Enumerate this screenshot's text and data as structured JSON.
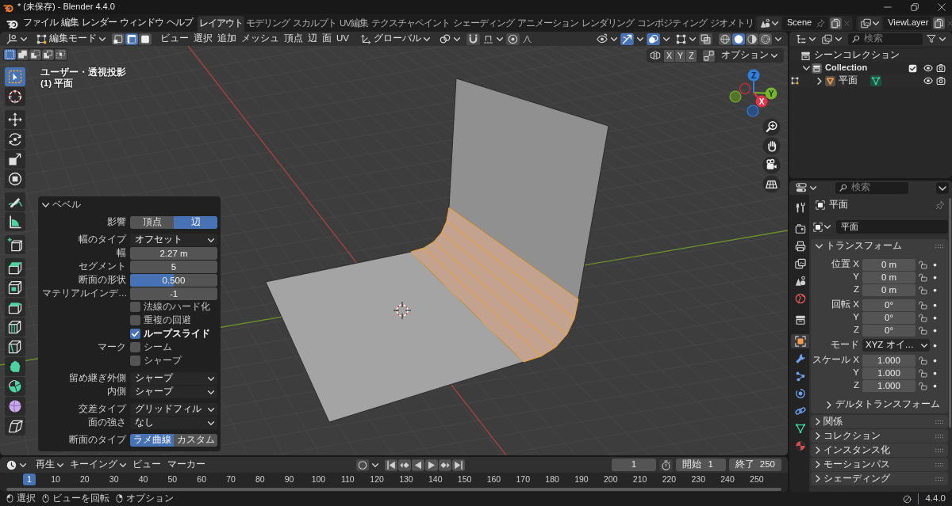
{
  "title_bar": {
    "title": "* (未保存) - Blender 4.4.0"
  },
  "top_bar": {
    "menus": [
      "ファイル",
      "編集",
      "レンダー",
      "ウィンドウ",
      "ヘルプ"
    ],
    "workspaces": [
      {
        "label": "レイアウト",
        "selected": true
      },
      {
        "label": "モデリング",
        "selected": false
      },
      {
        "label": "スカルプト",
        "selected": false
      },
      {
        "label": "UV編集",
        "selected": false
      },
      {
        "label": "テクスチャペイント",
        "selected": false
      },
      {
        "label": "シェーディング",
        "selected": false
      },
      {
        "label": "アニメーション",
        "selected": false
      },
      {
        "label": "レンダリング",
        "selected": false
      },
      {
        "label": "コンポジティング",
        "selected": false
      },
      {
        "label": "ジオメトリ",
        "selected": false
      }
    ],
    "scene": "Scene",
    "view_layer": "ViewLayer"
  },
  "viewport_header": {
    "mode": "編集モード",
    "select_modes": [
      {
        "kind": "vertex",
        "selected": false
      },
      {
        "kind": "edge",
        "selected": true
      },
      {
        "kind": "face",
        "selected": false
      }
    ],
    "menus": [
      "ビュー",
      "選択",
      "追加",
      "メッシュ",
      "頂点",
      "辺",
      "面",
      "UV"
    ],
    "orientation": "グローバル",
    "toggles": [
      {
        "kind": "snap",
        "on": false
      },
      {
        "kind": "proportional",
        "on": false
      },
      {
        "kind": "gizmos",
        "on": true
      },
      {
        "kind": "overlays",
        "on": true
      },
      {
        "kind": "xray",
        "on": false
      }
    ],
    "shading_modes": [
      {
        "kind": "wireframe",
        "selected": false
      },
      {
        "kind": "solid",
        "selected": true
      },
      {
        "kind": "material",
        "selected": false
      },
      {
        "kind": "rendered",
        "selected": false
      }
    ]
  },
  "viewport": {
    "selection_ops": [
      {
        "kind": "set",
        "selected": true
      },
      {
        "kind": "extend",
        "selected": false
      },
      {
        "kind": "subtract",
        "selected": false
      },
      {
        "kind": "invert",
        "selected": false
      },
      {
        "kind": "intersect",
        "selected": false
      }
    ],
    "view_name": "ユーザー・透視投影",
    "object_label": "(1) 平面",
    "mirror_axes": [
      {
        "label": "X",
        "on": false
      },
      {
        "label": "Y",
        "on": false
      },
      {
        "label": "Z",
        "on": false
      }
    ],
    "options": "オプション",
    "gizmo": [
      {
        "kind": "z",
        "label": "Z"
      },
      {
        "kind": "y",
        "label": "Y"
      },
      {
        "kind": "x",
        "label": "X"
      }
    ],
    "tool_groups": [
      {
        "tools": [
          {
            "kind": "select_box",
            "selected": true
          },
          {
            "kind": "cursor",
            "selected": false
          }
        ]
      },
      {
        "tools": [
          {
            "kind": "move",
            "selected": false
          },
          {
            "kind": "rotate",
            "selected": false
          },
          {
            "kind": "scale",
            "selected": false
          },
          {
            "kind": "transform",
            "selected": false
          }
        ]
      },
      {
        "tools": [
          {
            "kind": "annotate",
            "selected": false
          },
          {
            "kind": "measure",
            "selected": false
          }
        ]
      },
      {
        "tools": [
          {
            "kind": "add_cube",
            "selected": false
          }
        ]
      },
      {
        "tools": [
          {
            "kind": "extrude",
            "selected": false
          },
          {
            "kind": "inset",
            "selected": false
          },
          {
            "kind": "bevel",
            "selected": false
          },
          {
            "kind": "loop_cut",
            "selected": false
          },
          {
            "kind": "knife",
            "selected": false
          },
          {
            "kind": "poly_build",
            "selected": false
          },
          {
            "kind": "spin",
            "selected": false
          },
          {
            "kind": "smooth",
            "selected": false
          },
          {
            "kind": "shear",
            "selected": false
          }
        ]
      }
    ]
  },
  "bevel_panel": {
    "title": "ベベル",
    "expanded": true,
    "sections": [
      {
        "rows": [
          {
            "kind": "toggle",
            "label": "影響",
            "options": [
              {
                "label": "頂点",
                "selected": false
              },
              {
                "label": "辺",
                "selected": true
              }
            ]
          }
        ]
      },
      {
        "rows": [
          {
            "kind": "dropdown",
            "label": "幅のタイプ",
            "value": "オフセット"
          },
          {
            "kind": "number",
            "label": "幅",
            "value": "2.27 m"
          },
          {
            "kind": "number",
            "label": "セグメント",
            "value": "5"
          },
          {
            "kind": "slider",
            "label": "断面の形状",
            "value": "0.500",
            "level": 0.5
          },
          {
            "kind": "number",
            "label": "マテリアルインデ…",
            "value": "-1"
          },
          {
            "kind": "checkbox",
            "text": "法線のハード化",
            "checked": false
          },
          {
            "kind": "checkbox",
            "text": "重複の回避",
            "checked": false
          },
          {
            "kind": "checkbox",
            "text": "ループスライド",
            "checked": true
          },
          {
            "kind": "checkbox",
            "label": "マーク",
            "text": "シーム",
            "checked": false
          },
          {
            "kind": "checkbox",
            "text": "シャープ",
            "checked": false
          }
        ]
      },
      {
        "rows": [
          {
            "kind": "dropdown",
            "label": "留め継ぎ外側",
            "value": "シャープ"
          },
          {
            "kind": "dropdown",
            "label": "内側",
            "value": "シャープ"
          }
        ]
      },
      {
        "rows": [
          {
            "kind": "dropdown",
            "label": "交差タイプ",
            "value": "グリッドフィル"
          },
          {
            "kind": "dropdown",
            "label": "面の強さ",
            "value": "なし"
          }
        ]
      },
      {
        "rows": [
          {
            "kind": "toggle",
            "label": "断面のタイプ",
            "options": [
              {
                "label": "ラメ曲線",
                "selected": true
              },
              {
                "label": "カスタム",
                "selected": false
              }
            ]
          }
        ]
      }
    ]
  },
  "outliner": {
    "search_placeholder": "検索",
    "tree": [
      {
        "kind": "scene_collection",
        "label": "シーンコレクション",
        "children": [
          {
            "kind": "collection",
            "label": "Collection",
            "expanded": true,
            "checked": true,
            "children": [
              {
                "kind": "mesh_object",
                "label": "平面",
                "expanded": false
              }
            ]
          }
        ]
      }
    ]
  },
  "properties": {
    "search_placeholder": "検索",
    "tabs": [
      {
        "kind": "tool",
        "selected": false
      },
      {
        "kind": "render",
        "selected": false
      },
      {
        "kind": "output",
        "selected": false
      },
      {
        "kind": "view_layer",
        "selected": false
      },
      {
        "kind": "scene",
        "selected": false
      },
      {
        "kind": "world",
        "selected": false
      },
      {
        "kind": "collection",
        "selected": false
      },
      {
        "kind": "object",
        "selected": true
      },
      {
        "kind": "modifiers",
        "selected": false
      },
      {
        "kind": "particles",
        "selected": false
      },
      {
        "kind": "physics",
        "selected": false
      },
      {
        "kind": "constraints",
        "selected": false
      },
      {
        "kind": "data",
        "selected": false
      },
      {
        "kind": "material",
        "selected": false
      }
    ],
    "context_name": "平面",
    "data_block": "平面",
    "panels": [
      {
        "title": "トランスフォーム",
        "expanded": true,
        "groups": [
          {
            "rows": [
              {
                "kind": "number",
                "label": "位置 X",
                "value": "0 m"
              },
              {
                "kind": "number",
                "label": "Y",
                "value": "0 m"
              },
              {
                "kind": "number",
                "label": "Z",
                "value": "0 m"
              }
            ]
          },
          {
            "rows": [
              {
                "kind": "number",
                "label": "回転 X",
                "value": "0°"
              },
              {
                "kind": "number",
                "label": "Y",
                "value": "0°"
              },
              {
                "kind": "number",
                "label": "Z",
                "value": "0°"
              }
            ]
          },
          {
            "rows": [
              {
                "kind": "dropdown",
                "label": "モード",
                "value": "XYZ オイ…"
              }
            ]
          },
          {
            "rows": [
              {
                "kind": "number",
                "label": "スケール X",
                "value": "1.000"
              },
              {
                "kind": "number",
                "label": "Y",
                "value": "1.000"
              },
              {
                "kind": "number",
                "label": "Z",
                "value": "1.000"
              }
            ]
          }
        ],
        "subpanels": [
          {
            "title": "デルタトランスフォーム",
            "expanded": false
          }
        ]
      },
      {
        "title": "関係",
        "expanded": false
      },
      {
        "title": "コレクション",
        "expanded": false
      },
      {
        "title": "インスタンス化",
        "expanded": false
      },
      {
        "title": "モーションパス",
        "expanded": false
      },
      {
        "title": "シェーディング",
        "expanded": false
      }
    ]
  },
  "timeline": {
    "menus": [
      {
        "label": "再生",
        "dropdown": true
      },
      {
        "label": "キーイング",
        "dropdown": true
      },
      {
        "label": "ビュー",
        "dropdown": false
      },
      {
        "label": "マーカー",
        "dropdown": false
      }
    ],
    "current_frame": "1",
    "start_label": "開始",
    "start": "1",
    "end_label": "終了",
    "end": "250",
    "playhead": "1",
    "ruler": [
      "10",
      "20",
      "30",
      "40",
      "50",
      "60",
      "70",
      "80",
      "90",
      "100",
      "110",
      "120",
      "130",
      "140",
      "150",
      "160",
      "170",
      "180",
      "190",
      "200",
      "210",
      "220",
      "230",
      "240",
      "250"
    ]
  },
  "status_bar": {
    "hints": [
      {
        "kind": "left_click",
        "text": "選択"
      },
      {
        "kind": "middle_click",
        "text": "ビューを回転"
      },
      {
        "kind": "right_click",
        "text": "オプション"
      }
    ],
    "version": "4.4.0"
  }
}
